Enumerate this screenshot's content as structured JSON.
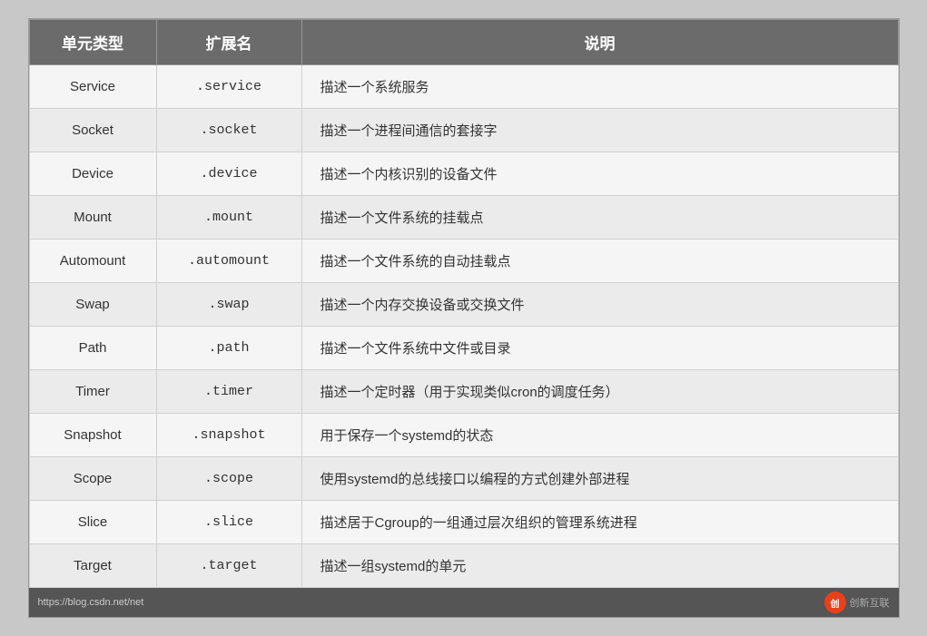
{
  "table": {
    "headers": [
      "单元类型",
      "扩展名",
      "说明"
    ],
    "rows": [
      {
        "type": "Service",
        "ext": ".service",
        "desc": "描述一个系统服务"
      },
      {
        "type": "Socket",
        "ext": ".socket",
        "desc": "描述一个进程间通信的套接字"
      },
      {
        "type": "Device",
        "ext": ".device",
        "desc": "描述一个内核识别的设备文件"
      },
      {
        "type": "Mount",
        "ext": ".mount",
        "desc": "描述一个文件系统的挂载点"
      },
      {
        "type": "Automount",
        "ext": ".automount",
        "desc": "描述一个文件系统的自动挂载点"
      },
      {
        "type": "Swap",
        "ext": ".swap",
        "desc": "描述一个内存交换设备或交换文件"
      },
      {
        "type": "Path",
        "ext": ".path",
        "desc": "描述一个文件系统中文件或目录"
      },
      {
        "type": "Timer",
        "ext": ".timer",
        "desc": "描述一个定时器（用于实现类似cron的调度任务）"
      },
      {
        "type": "Snapshot",
        "ext": ".snapshot",
        "desc": "用于保存一个systemd的状态"
      },
      {
        "type": "Scope",
        "ext": ".scope",
        "desc": "使用systemd的总线接口以编程的方式创建外部进程"
      },
      {
        "type": "Slice",
        "ext": ".slice",
        "desc": "描述居于Cgroup的一组通过层次组织的管理系统进程"
      },
      {
        "type": "Target",
        "ext": ".target",
        "desc": "描述一组systemd的单元"
      }
    ]
  },
  "footer": {
    "url": "https://blog.csdn.net/net",
    "logo_text": "创新互联"
  }
}
